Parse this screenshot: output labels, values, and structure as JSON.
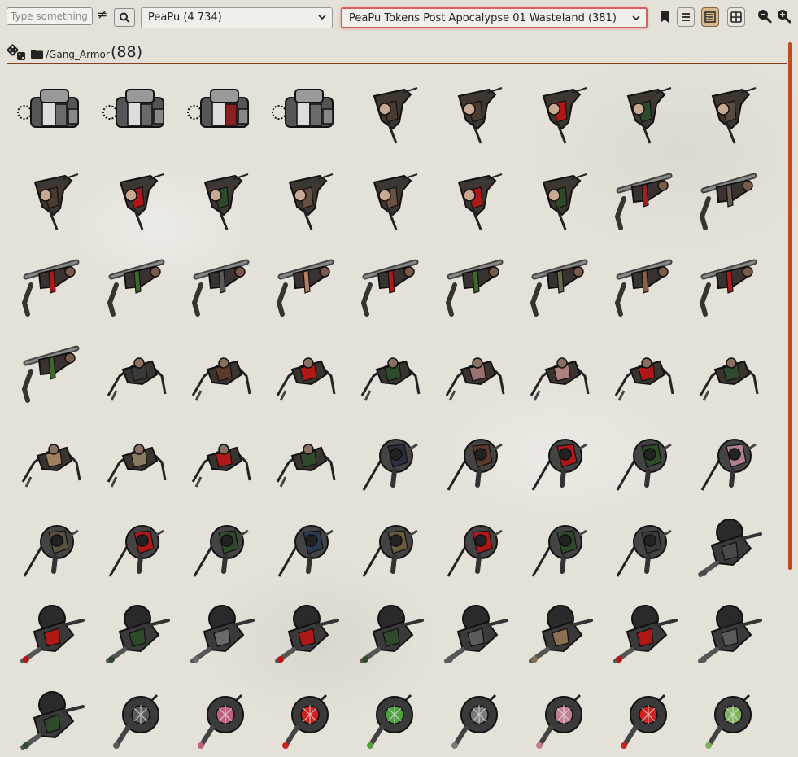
{
  "toolbar": {
    "search_placeholder": "Type something to search",
    "not_equal_symbol": "≠",
    "search_icon": "magnifier-icon",
    "collection_select": "PeaPu (4 734)",
    "pack_select": "PeaPu Tokens Post Apocalypse 01 Wasteland (381)",
    "icons": [
      "bookmark-icon",
      "list-view-icon",
      "detail-view-icon",
      "grid-view-icon",
      "zoom-out-icon",
      "zoom-in-icon"
    ],
    "active_view": "detail-view-icon"
  },
  "folder": {
    "path": "/Gang_Armor",
    "count": "(88)"
  },
  "colors": {
    "accent": "#c24a1e",
    "active_button": "#d9b68a",
    "highlight_border": "#d46060"
  },
  "tokens": [
    "mech",
    "mech",
    "mech",
    "mech",
    "raider",
    "raider",
    "raider",
    "raider",
    "raider",
    "raider",
    "raider",
    "raider",
    "raider",
    "raider",
    "raider",
    "raider",
    "clubber",
    "clubber",
    "clubber",
    "clubber",
    "clubber",
    "clubber",
    "clubber",
    "clubber",
    "clubber",
    "clubber",
    "clubber",
    "clubber",
    "crawler",
    "crawler",
    "crawler",
    "crawler",
    "crawler",
    "crawler",
    "crawler",
    "crawler",
    "crawler",
    "crawler",
    "crawler",
    "crawler",
    "swordsman",
    "swordsman",
    "swordsman",
    "swordsman",
    "swordsman",
    "swordsman",
    "swordsman",
    "swordsman",
    "swordsman",
    "swordsman",
    "swordsman",
    "swordsman",
    "swordsman",
    "heavy",
    "heavy",
    "heavy",
    "heavy",
    "heavy",
    "heavy",
    "heavy",
    "heavy",
    "heavy",
    "heavy",
    "heavy",
    "brute",
    "brute",
    "brute",
    "brute",
    "brute",
    "brute",
    "brute",
    "brute"
  ],
  "token_tints": [
    "#6a6a6a",
    "#6a6a6a",
    "#8a2020",
    "#6a6a6a",
    "#4a3c30",
    "#4a3c30",
    "#b01818",
    "#2f4a2a",
    "#5a4a40",
    "#4a3c30",
    "#b01818",
    "#2f4a2a",
    "#6a5040",
    "#6a5040",
    "#b01818",
    "#2f4a2a",
    "#a02020",
    "#6a5a4a",
    "#b01818",
    "#3a6a2a",
    "#5a5a5a",
    "#b08060",
    "#b01818",
    "#3a6a2a",
    "#6a6a50",
    "#8a6040",
    "#b01818",
    "#3a6a2a",
    "#3a3a3a",
    "#5a3a2a",
    "#b01818",
    "#2f4a2a",
    "#9a7070",
    "#b08080",
    "#b01818",
    "#2f4a2a",
    "#a08060",
    "#8a7a60",
    "#b01818",
    "#2f4a2a",
    "#2a3040",
    "#5a3a2a",
    "#b01818",
    "#2f4a2a",
    "#b08090",
    "#5a5040",
    "#b01818",
    "#2f4a2a",
    "#2a3a50",
    "#6a5a40",
    "#b01818",
    "#2f4a2a",
    "#3a3a3a",
    "#4a4a4a",
    "#b01818",
    "#2f4a2a",
    "#6a6a6a",
    "#b01818",
    "#2f4a2a",
    "#5a5a5a",
    "#8a7050",
    "#b01818",
    "#5a5a5a",
    "#2f4a2a",
    "#5a5a5a",
    "#c06080",
    "#d02020",
    "#50a040",
    "#7a7a7a",
    "#c08090",
    "#d02020",
    "#80b060"
  ]
}
